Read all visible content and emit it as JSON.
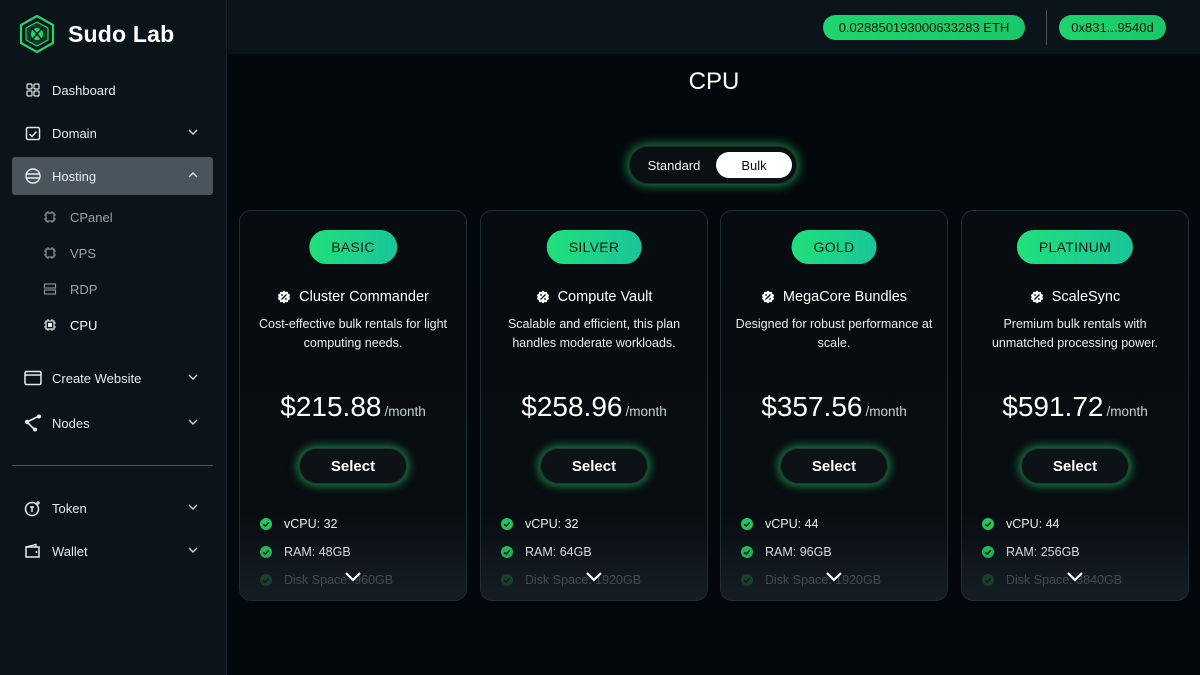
{
  "brand": {
    "name": "Sudo Lab"
  },
  "header": {
    "eth_balance": "0.028850193000633283 ETH",
    "wallet_address": "0x831...9540d"
  },
  "sidebar": {
    "items": [
      {
        "label": "Dashboard",
        "icon": "grid-icon"
      },
      {
        "label": "Domain",
        "icon": "calendar-check-icon"
      },
      {
        "label": "Hosting",
        "icon": "hosting-icon",
        "expanded": true
      },
      {
        "label": "Create Website",
        "icon": "browser-window-icon"
      },
      {
        "label": "Nodes",
        "icon": "share-nodes-icon"
      },
      {
        "label": "Token",
        "icon": "token-icon"
      },
      {
        "label": "Wallet",
        "icon": "wallet-icon"
      }
    ],
    "hosting_sub": [
      {
        "label": "CPanel",
        "icon": "chip-icon"
      },
      {
        "label": "VPS",
        "icon": "chip-icon"
      },
      {
        "label": "RDP",
        "icon": "server-icon"
      },
      {
        "label": "CPU",
        "icon": "chip-icon",
        "current": true
      }
    ]
  },
  "main": {
    "title": "CPU",
    "toggle": {
      "standard": "Standard",
      "bulk": "Bulk",
      "selected": "Bulk"
    },
    "plans": [
      {
        "tier": "BASIC",
        "name": "Cluster Commander",
        "description": "Cost-effective bulk rentals for light computing needs.",
        "price": "$215.88",
        "period": "/month",
        "select_label": "Select",
        "features": [
          "vCPU: 32",
          "RAM: 48GB",
          "Disk Space: 960GB"
        ]
      },
      {
        "tier": "SILVER",
        "name": "Compute Vault",
        "description": "Scalable and efficient, this plan handles moderate workloads.",
        "price": "$258.96",
        "period": "/month",
        "select_label": "Select",
        "features": [
          "vCPU: 32",
          "RAM: 64GB",
          "Disk Space: 1920GB"
        ]
      },
      {
        "tier": "GOLD",
        "name": "MegaCore Bundles",
        "description": "Designed for robust performance at scale.",
        "price": "$357.56",
        "period": "/month",
        "select_label": "Select",
        "features": [
          "vCPU: 44",
          "RAM: 96GB",
          "Disk Space: 1920GB"
        ]
      },
      {
        "tier": "PLATINUM",
        "name": "ScaleSync",
        "description": "Premium bulk rentals with unmatched processing power.",
        "price": "$591.72",
        "period": "/month",
        "select_label": "Select",
        "features": [
          "vCPU: 44",
          "RAM: 256GB",
          "Disk Space: 3840GB"
        ]
      }
    ]
  },
  "colors": {
    "accent": "#1ed46c",
    "background": "#03080c",
    "sidebar": "#0b141a",
    "active_item": "#4a545c"
  }
}
